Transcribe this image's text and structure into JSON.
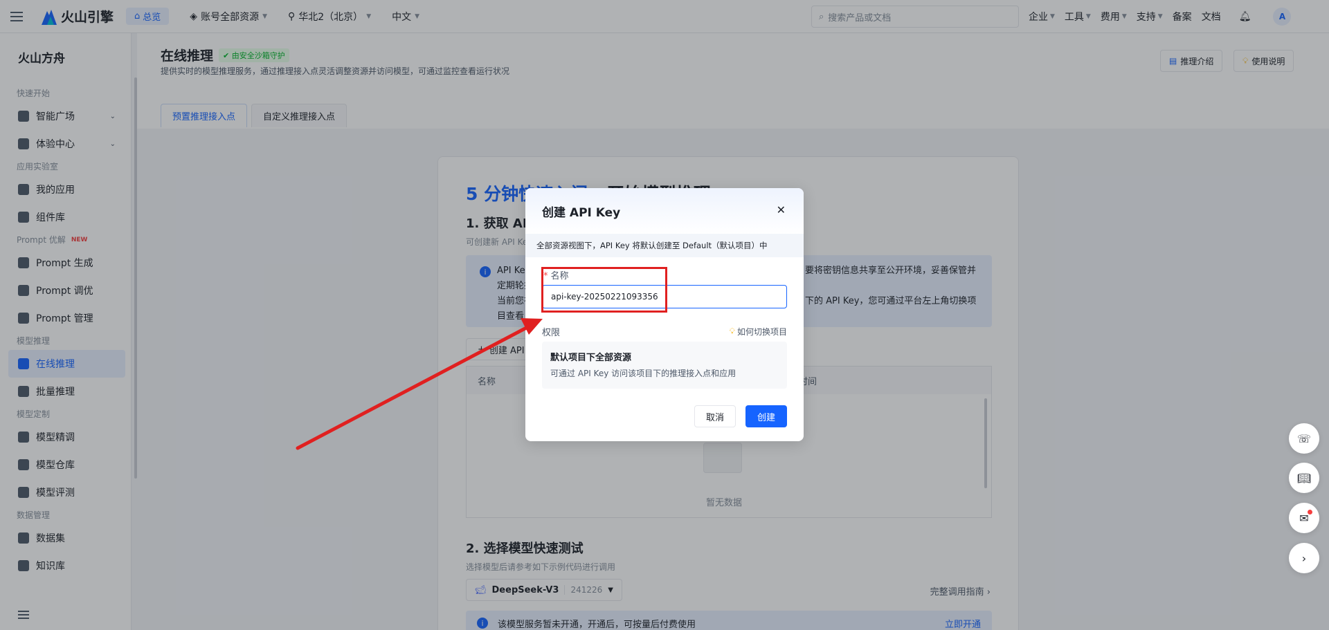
{
  "topbar": {
    "logo": "火山引擎",
    "home": "总览",
    "account": "账号全部资源",
    "region": "华北2（北京）",
    "lang": "中文",
    "search_placeholder": "搜索产品或文档",
    "right_items": [
      "企业",
      "工具",
      "费用",
      "支持",
      "备案",
      "文档"
    ],
    "avatar": "A"
  },
  "sidebar": {
    "title": "火山方舟",
    "sections": [
      {
        "label": "快速开始",
        "items": [
          {
            "label": "智能广场",
            "icon": "bulb-icon",
            "chevron": true
          },
          {
            "label": "体验中心",
            "icon": "box-icon",
            "chevron": true
          }
        ]
      },
      {
        "label": "应用实验室",
        "items": [
          {
            "label": "我的应用",
            "icon": "apps-icon"
          },
          {
            "label": "组件库",
            "icon": "components-icon"
          }
        ]
      },
      {
        "label": "Prompt 优解",
        "badge": "NEW",
        "items": [
          {
            "label": "Prompt 生成",
            "icon": "terminal-icon"
          },
          {
            "label": "Prompt 调优",
            "icon": "edit-icon"
          },
          {
            "label": "Prompt 管理",
            "icon": "message-icon"
          }
        ]
      },
      {
        "label": "模型推理",
        "items": [
          {
            "label": "在线推理",
            "icon": "chart-icon",
            "active": true
          },
          {
            "label": "批量推理",
            "icon": "batch-icon"
          }
        ]
      },
      {
        "label": "模型定制",
        "items": [
          {
            "label": "模型精调",
            "icon": "tune-icon"
          },
          {
            "label": "模型仓库",
            "icon": "cube-icon"
          },
          {
            "label": "模型评测",
            "icon": "flask-icon"
          }
        ]
      },
      {
        "label": "数据管理",
        "items": [
          {
            "label": "数据集",
            "icon": "dataset-icon"
          },
          {
            "label": "知识库",
            "icon": "kb-icon"
          }
        ]
      }
    ]
  },
  "page": {
    "title": "在线推理",
    "safe_badge": "由安全沙箱守护",
    "subtitle": "提供实时的模型推理服务，通过推理接入点灵活调整资源并访问模型，可通过监控查看运行状况",
    "btn_intro": "推理介绍",
    "btn_help": "使用说明",
    "tabs": [
      "预置推理接入点",
      "自定义推理接入点"
    ]
  },
  "card": {
    "heading_blue": "5 分钟快速入门",
    "heading_rest": "- 开始模型推理",
    "step1": "1. 获取 API Key",
    "step1_sub": "可创建新 API Key",
    "info_left_1": "API Key",
    "info_left_2": "定期轮换",
    "info_left_3": "当前您在",
    "info_left_4": "目查看",
    "info_right_1": "要将密钥信息共享至公开环境，妥善保管并",
    "info_right_3": "下的 API Key，您可通过平台左上角切换项",
    "create_btn": "创建 API",
    "col_name": "名称",
    "col_time": "时间",
    "empty": "暂无数据",
    "step2": "2. 选择模型快速测试",
    "step2_sub": "选择模型后请参考如下示例代码进行调用",
    "model": "DeepSeek-V3",
    "model_version": "241226",
    "guide": "完整调用指南 ›",
    "notice": "该模型服务暂未开通，开通后，可按量后付费使用",
    "open": "立即开通"
  },
  "modal": {
    "title": "创建 API Key",
    "notice": "全部资源视图下，API Key 将默认创建至 Default（默认项目）中",
    "name_label": "名称",
    "name_value": "api-key-20250221093356",
    "perm_label": "权限",
    "perm_help": "如何切换项目",
    "perm_title": "默认项目下全部资源",
    "perm_desc": "可通过 API Key 访问该项目下的推理接入点和应用",
    "cancel": "取消",
    "create": "创建"
  },
  "colors": {
    "accent": "#1664ff",
    "annotation": "#e02020"
  }
}
